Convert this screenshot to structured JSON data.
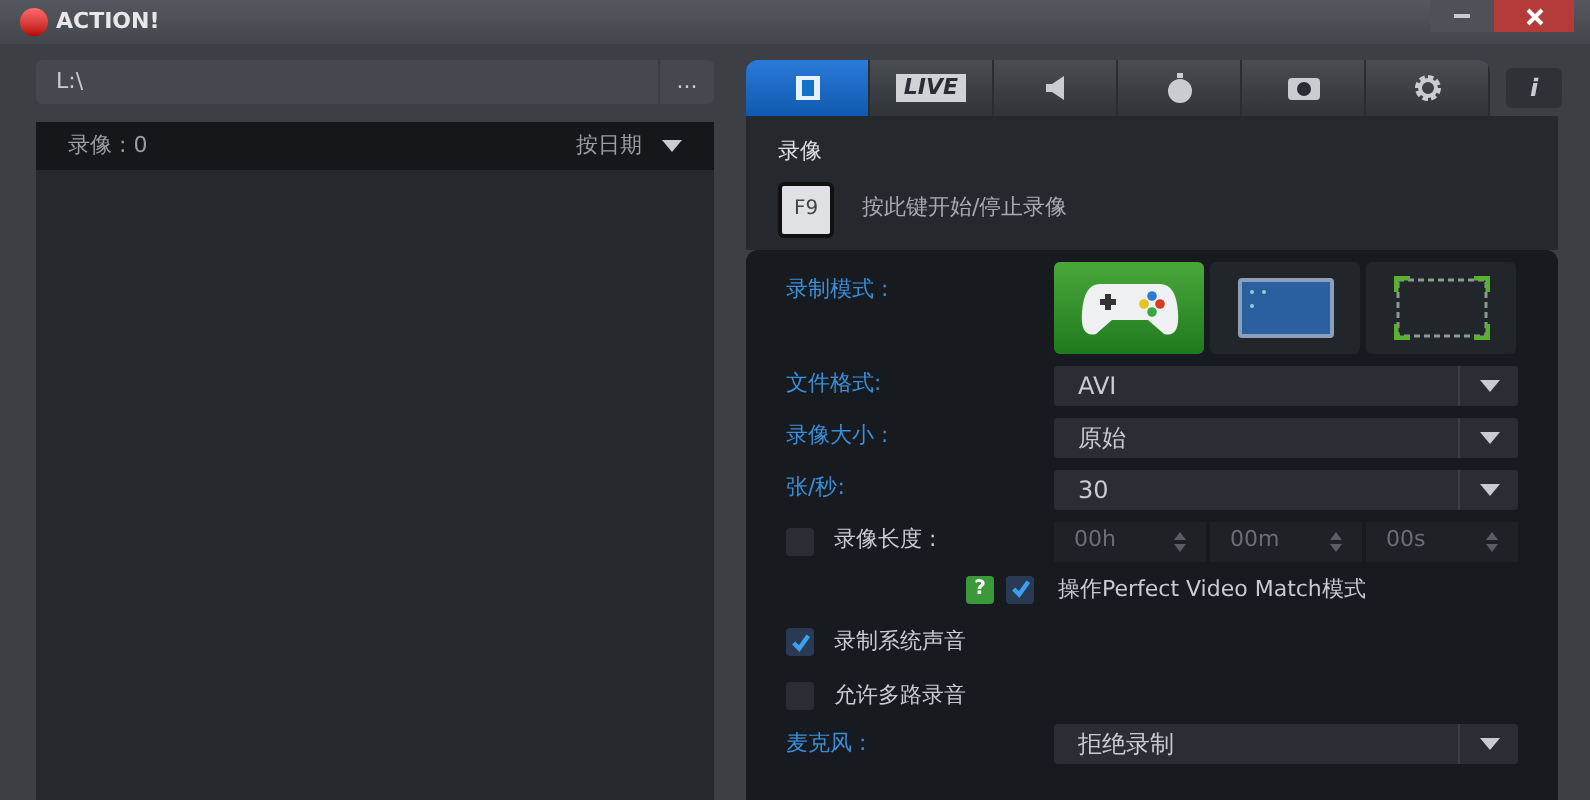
{
  "window": {
    "title": "ACTION!"
  },
  "path_field": {
    "value": "L:\\",
    "browse": "..."
  },
  "recordings": {
    "count_label": "录像 : 0",
    "sort": "按日期"
  },
  "tabs": [
    {
      "kind": "film",
      "selected": true
    },
    {
      "kind": "live",
      "label": "LIVE",
      "selected": false
    },
    {
      "kind": "speaker",
      "selected": false
    },
    {
      "kind": "stopwatch",
      "selected": false
    },
    {
      "kind": "camera",
      "selected": false
    },
    {
      "kind": "gear",
      "selected": false
    }
  ],
  "info_button": "i",
  "hotkey": {
    "title": "录像",
    "key": "F9",
    "description": "按此键开始/停止录像"
  },
  "mode": {
    "label": "录制模式 :",
    "options": [
      {
        "kind": "gamepad",
        "selected": true
      },
      {
        "kind": "screen",
        "selected": false
      },
      {
        "kind": "region",
        "selected": false
      }
    ]
  },
  "dropdowns": [
    {
      "label": "文件格式:",
      "value": "AVI"
    },
    {
      "label": "录像大小 :",
      "value": "原始"
    },
    {
      "label": "张/秒:",
      "value": "30"
    }
  ],
  "duration": {
    "label": "录像长度 :",
    "checked": false,
    "fields": [
      "00h",
      "00m",
      "00s"
    ]
  },
  "perfect_match": {
    "help": "?",
    "label": "操作Perfect Video Match模式",
    "checked": true
  },
  "options": [
    {
      "label": "录制系统声音",
      "checked": true
    },
    {
      "label": "允许多路录音",
      "checked": false
    }
  ],
  "microphone": {
    "label": "麦克风 :",
    "value": "拒绝录制"
  }
}
